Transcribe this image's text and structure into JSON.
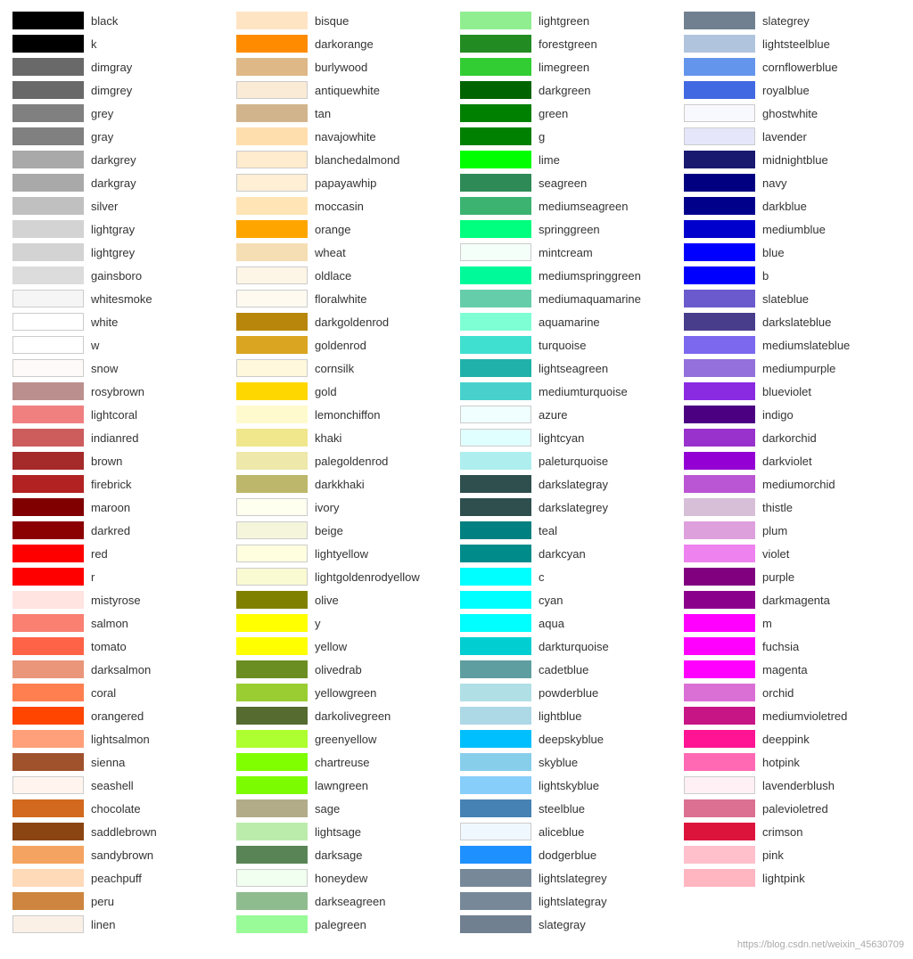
{
  "columns": [
    {
      "items": [
        {
          "name": "black",
          "color": "#000000"
        },
        {
          "name": "k",
          "color": "#000000"
        },
        {
          "name": "dimgray",
          "color": "#696969"
        },
        {
          "name": "dimgrey",
          "color": "#696969"
        },
        {
          "name": "grey",
          "color": "#808080"
        },
        {
          "name": "gray",
          "color": "#808080"
        },
        {
          "name": "darkgrey",
          "color": "#a9a9a9"
        },
        {
          "name": "darkgray",
          "color": "#a9a9a9"
        },
        {
          "name": "silver",
          "color": "#c0c0c0"
        },
        {
          "name": "lightgray",
          "color": "#d3d3d3"
        },
        {
          "name": "lightgrey",
          "color": "#d3d3d3"
        },
        {
          "name": "gainsboro",
          "color": "#dcdcdc"
        },
        {
          "name": "whitesmoke",
          "color": "#f5f5f5"
        },
        {
          "name": "white",
          "color": "#ffffff"
        },
        {
          "name": "w",
          "color": "#ffffff"
        },
        {
          "name": "snow",
          "color": "#fffafa"
        },
        {
          "name": "rosybrown",
          "color": "#bc8f8f"
        },
        {
          "name": "lightcoral",
          "color": "#f08080"
        },
        {
          "name": "indianred",
          "color": "#cd5c5c"
        },
        {
          "name": "brown",
          "color": "#a52a2a"
        },
        {
          "name": "firebrick",
          "color": "#b22222"
        },
        {
          "name": "maroon",
          "color": "#800000"
        },
        {
          "name": "darkred",
          "color": "#8b0000"
        },
        {
          "name": "red",
          "color": "#ff0000"
        },
        {
          "name": "r",
          "color": "#ff0000"
        },
        {
          "name": "mistyrose",
          "color": "#ffe4e1"
        },
        {
          "name": "salmon",
          "color": "#fa8072"
        },
        {
          "name": "tomato",
          "color": "#ff6347"
        },
        {
          "name": "darksalmon",
          "color": "#e9967a"
        },
        {
          "name": "coral",
          "color": "#ff7f50"
        },
        {
          "name": "orangered",
          "color": "#ff4500"
        },
        {
          "name": "lightsalmon",
          "color": "#ffa07a"
        },
        {
          "name": "sienna",
          "color": "#a0522d"
        },
        {
          "name": "seashell",
          "color": "#fff5ee"
        },
        {
          "name": "chocolate",
          "color": "#d2691e"
        },
        {
          "name": "saddlebrown",
          "color": "#8b4513"
        },
        {
          "name": "sandybrown",
          "color": "#f4a460"
        },
        {
          "name": "peachpuff",
          "color": "#ffdab9"
        },
        {
          "name": "peru",
          "color": "#cd853f"
        },
        {
          "name": "linen",
          "color": "#faf0e6"
        }
      ]
    },
    {
      "items": [
        {
          "name": "bisque",
          "color": "#ffe4c4"
        },
        {
          "name": "darkorange",
          "color": "#ff8c00"
        },
        {
          "name": "burlywood",
          "color": "#deb887"
        },
        {
          "name": "antiquewhite",
          "color": "#faebd7"
        },
        {
          "name": "tan",
          "color": "#d2b48c"
        },
        {
          "name": "navajowhite",
          "color": "#ffdead"
        },
        {
          "name": "blanchedalmond",
          "color": "#ffebcd"
        },
        {
          "name": "papayawhip",
          "color": "#ffefd5"
        },
        {
          "name": "moccasin",
          "color": "#ffe4b5"
        },
        {
          "name": "orange",
          "color": "#ffa500"
        },
        {
          "name": "wheat",
          "color": "#f5deb3"
        },
        {
          "name": "oldlace",
          "color": "#fdf5e6"
        },
        {
          "name": "floralwhite",
          "color": "#fffaf0"
        },
        {
          "name": "darkgoldenrod",
          "color": "#b8860b"
        },
        {
          "name": "goldenrod",
          "color": "#daa520"
        },
        {
          "name": "cornsilk",
          "color": "#fff8dc"
        },
        {
          "name": "gold",
          "color": "#ffd700"
        },
        {
          "name": "lemonchiffon",
          "color": "#fffacd"
        },
        {
          "name": "khaki",
          "color": "#f0e68c"
        },
        {
          "name": "palegoldenrod",
          "color": "#eee8aa"
        },
        {
          "name": "darkkhaki",
          "color": "#bdb76b"
        },
        {
          "name": "ivory",
          "color": "#fffff0"
        },
        {
          "name": "beige",
          "color": "#f5f5dc"
        },
        {
          "name": "lightyellow",
          "color": "#ffffe0"
        },
        {
          "name": "lightgoldenrodyellow",
          "color": "#fafad2"
        },
        {
          "name": "olive",
          "color": "#808000"
        },
        {
          "name": "y",
          "color": "#ffff00"
        },
        {
          "name": "yellow",
          "color": "#ffff00"
        },
        {
          "name": "olivedrab",
          "color": "#6b8e23"
        },
        {
          "name": "yellowgreen",
          "color": "#9acd32"
        },
        {
          "name": "darkolivegreen",
          "color": "#556b2f"
        },
        {
          "name": "greenyellow",
          "color": "#adff2f"
        },
        {
          "name": "chartreuse",
          "color": "#7fff00"
        },
        {
          "name": "lawngreen",
          "color": "#7cfc00"
        },
        {
          "name": "sage",
          "color": "#b2ac88"
        },
        {
          "name": "lightsage",
          "color": "#bcecac"
        },
        {
          "name": "darksage",
          "color": "#598556"
        },
        {
          "name": "honeydew",
          "color": "#f0fff0"
        },
        {
          "name": "darkseagreen",
          "color": "#8fbc8f"
        },
        {
          "name": "palegreen",
          "color": "#98fb98"
        }
      ]
    },
    {
      "items": [
        {
          "name": "lightgreen",
          "color": "#90ee90"
        },
        {
          "name": "forestgreen",
          "color": "#228b22"
        },
        {
          "name": "limegreen",
          "color": "#32cd32"
        },
        {
          "name": "darkgreen",
          "color": "#006400"
        },
        {
          "name": "green",
          "color": "#008000"
        },
        {
          "name": "g",
          "color": "#008000"
        },
        {
          "name": "lime",
          "color": "#00ff00"
        },
        {
          "name": "seagreen",
          "color": "#2e8b57"
        },
        {
          "name": "mediumseagreen",
          "color": "#3cb371"
        },
        {
          "name": "springgreen",
          "color": "#00ff7f"
        },
        {
          "name": "mintcream",
          "color": "#f5fffa"
        },
        {
          "name": "mediumspringgreen",
          "color": "#00fa9a"
        },
        {
          "name": "mediumaquamarine",
          "color": "#66cdaa"
        },
        {
          "name": "aquamarine",
          "color": "#7fffd4"
        },
        {
          "name": "turquoise",
          "color": "#40e0d0"
        },
        {
          "name": "lightseagreen",
          "color": "#20b2aa"
        },
        {
          "name": "mediumturquoise",
          "color": "#48d1cc"
        },
        {
          "name": "azure",
          "color": "#f0ffff"
        },
        {
          "name": "lightcyan",
          "color": "#e0ffff"
        },
        {
          "name": "paleturquoise",
          "color": "#afeeee"
        },
        {
          "name": "darkslategray",
          "color": "#2f4f4f"
        },
        {
          "name": "darkslategrey",
          "color": "#2f4f4f"
        },
        {
          "name": "teal",
          "color": "#008080"
        },
        {
          "name": "darkcyan",
          "color": "#008b8b"
        },
        {
          "name": "c",
          "color": "#00ffff"
        },
        {
          "name": "cyan",
          "color": "#00ffff"
        },
        {
          "name": "aqua",
          "color": "#00ffff"
        },
        {
          "name": "darkturquoise",
          "color": "#00ced1"
        },
        {
          "name": "cadetblue",
          "color": "#5f9ea0"
        },
        {
          "name": "powderblue",
          "color": "#b0e0e6"
        },
        {
          "name": "lightblue",
          "color": "#add8e6"
        },
        {
          "name": "deepskyblue",
          "color": "#00bfff"
        },
        {
          "name": "skyblue",
          "color": "#87ceeb"
        },
        {
          "name": "lightskyblue",
          "color": "#87cefa"
        },
        {
          "name": "steelblue",
          "color": "#4682b4"
        },
        {
          "name": "aliceblue",
          "color": "#f0f8ff"
        },
        {
          "name": "dodgerblue",
          "color": "#1e90ff"
        },
        {
          "name": "lightslategrey",
          "color": "#778899"
        },
        {
          "name": "lightslategray",
          "color": "#778899"
        },
        {
          "name": "slategray",
          "color": "#708090"
        }
      ]
    },
    {
      "items": [
        {
          "name": "slategrey",
          "color": "#708090"
        },
        {
          "name": "lightsteelblue",
          "color": "#b0c4de"
        },
        {
          "name": "cornflowerblue",
          "color": "#6495ed"
        },
        {
          "name": "royalblue",
          "color": "#4169e1"
        },
        {
          "name": "ghostwhite",
          "color": "#f8f8ff"
        },
        {
          "name": "lavender",
          "color": "#e6e6fa"
        },
        {
          "name": "midnightblue",
          "color": "#191970"
        },
        {
          "name": "navy",
          "color": "#000080"
        },
        {
          "name": "darkblue",
          "color": "#00008b"
        },
        {
          "name": "mediumblue",
          "color": "#0000cd"
        },
        {
          "name": "blue",
          "color": "#0000ff"
        },
        {
          "name": "b",
          "color": "#0000ff"
        },
        {
          "name": "slateblue",
          "color": "#6a5acd"
        },
        {
          "name": "darkslateblue",
          "color": "#483d8b"
        },
        {
          "name": "mediumslateblue",
          "color": "#7b68ee"
        },
        {
          "name": "mediumpurple",
          "color": "#9370db"
        },
        {
          "name": "blueviolet",
          "color": "#8a2be2"
        },
        {
          "name": "indigo",
          "color": "#4b0082"
        },
        {
          "name": "darkorchid",
          "color": "#9932cc"
        },
        {
          "name": "darkviolet",
          "color": "#9400d3"
        },
        {
          "name": "mediumorchid",
          "color": "#ba55d3"
        },
        {
          "name": "thistle",
          "color": "#d8bfd8"
        },
        {
          "name": "plum",
          "color": "#dda0dd"
        },
        {
          "name": "violet",
          "color": "#ee82ee"
        },
        {
          "name": "purple",
          "color": "#800080"
        },
        {
          "name": "darkmagenta",
          "color": "#8b008b"
        },
        {
          "name": "m",
          "color": "#ff00ff"
        },
        {
          "name": "fuchsia",
          "color": "#ff00ff"
        },
        {
          "name": "magenta",
          "color": "#ff00ff"
        },
        {
          "name": "orchid",
          "color": "#da70d6"
        },
        {
          "name": "mediumvioletred",
          "color": "#c71585"
        },
        {
          "name": "deeppink",
          "color": "#ff1493"
        },
        {
          "name": "hotpink",
          "color": "#ff69b4"
        },
        {
          "name": "lavenderblush",
          "color": "#fff0f5"
        },
        {
          "name": "palevioletred",
          "color": "#db7093"
        },
        {
          "name": "crimson",
          "color": "#dc143c"
        },
        {
          "name": "pink",
          "color": "#ffc0cb"
        },
        {
          "name": "lightpink",
          "color": "#ffb6c1"
        }
      ]
    }
  ],
  "watermark": "https://blog.csdn.net/weixin_45630709"
}
